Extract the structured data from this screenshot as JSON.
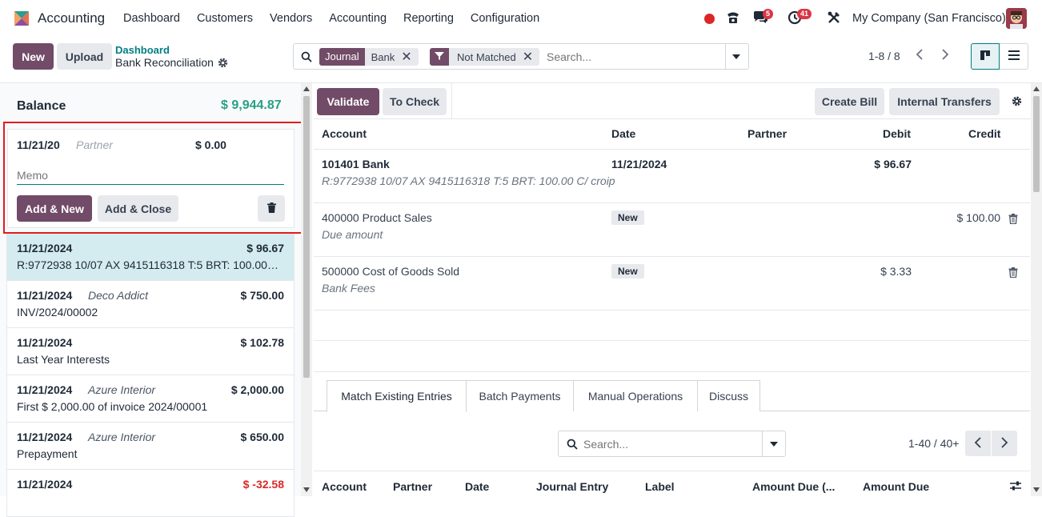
{
  "nav": {
    "app_name": "Accounting",
    "menu": [
      "Dashboard",
      "Customers",
      "Vendors",
      "Accounting",
      "Reporting",
      "Configuration"
    ],
    "chat_count": "5",
    "activity_count": "41",
    "company": "My Company (San Francisco)"
  },
  "control": {
    "new_label": "New",
    "upload_label": "Upload",
    "breadcrumb_parent": "Dashboard",
    "breadcrumb_current": "Bank Reconciliation",
    "facet1_tag": "Journal",
    "facet1_value": "Bank",
    "facet2_value": "Not Matched",
    "search_placeholder": "Search...",
    "pager": "1-8 / 8"
  },
  "left": {
    "balance_label": "Balance",
    "balance_value": "$ 9,944.87",
    "form": {
      "date": "11/21/20",
      "partner_placeholder": "Partner",
      "amount": "$ 0.00",
      "memo_placeholder": "Memo",
      "add_new": "Add & New",
      "add_close": "Add & Close"
    },
    "statements": [
      {
        "date": "11/21/2024",
        "partner": "",
        "amount": "$ 96.67",
        "ref": "R:9772938 10/07 AX 9415116318 T:5 BRT: 100.00 C/ croip",
        "neg": false
      },
      {
        "date": "11/21/2024",
        "partner": "Deco Addict",
        "amount": "$ 750.00",
        "ref": "INV/2024/00002",
        "neg": false
      },
      {
        "date": "11/21/2024",
        "partner": "",
        "amount": "$ 102.78",
        "ref": "Last Year Interests",
        "neg": false
      },
      {
        "date": "11/21/2024",
        "partner": "Azure Interior",
        "amount": "$ 2,000.00",
        "ref": "First $ 2,000.00 of invoice 2024/00001",
        "neg": false
      },
      {
        "date": "11/21/2024",
        "partner": "Azure Interior",
        "amount": "$ 650.00",
        "ref": "Prepayment",
        "neg": false
      },
      {
        "date": "11/21/2024",
        "partner": "",
        "amount": "$ -32.58",
        "ref": "",
        "neg": true
      }
    ]
  },
  "right": {
    "validate": "Validate",
    "to_check": "To Check",
    "create_bill": "Create Bill",
    "internal_transfers": "Internal Transfers",
    "headers": {
      "account": "Account",
      "date": "Date",
      "partner": "Partner",
      "debit": "Debit",
      "credit": "Credit"
    },
    "lines": [
      {
        "account": "101401 Bank",
        "sub": "R:9772938 10/07 AX 9415116318 T:5 BRT: 100.00 C/ croip",
        "date": "11/21/2024",
        "debit": "$ 96.67",
        "credit": ""
      },
      {
        "account": "400000 Product Sales",
        "sub": "Due amount",
        "badge": "New",
        "debit": "",
        "credit": "$ 100.00"
      },
      {
        "account": "500000 Cost of Goods Sold",
        "sub": "Bank Fees",
        "badge": "New",
        "debit": "$ 3.33",
        "credit": ""
      }
    ],
    "tabs": [
      "Match Existing Entries",
      "Batch Payments",
      "Manual Operations",
      "Discuss"
    ],
    "search_placeholder": "Search...",
    "pager": "1-40 / 40+",
    "bottom_headers": [
      "Account",
      "Partner",
      "Date",
      "Journal Entry",
      "Label",
      "Amount Due (...",
      "Amount Due"
    ]
  }
}
